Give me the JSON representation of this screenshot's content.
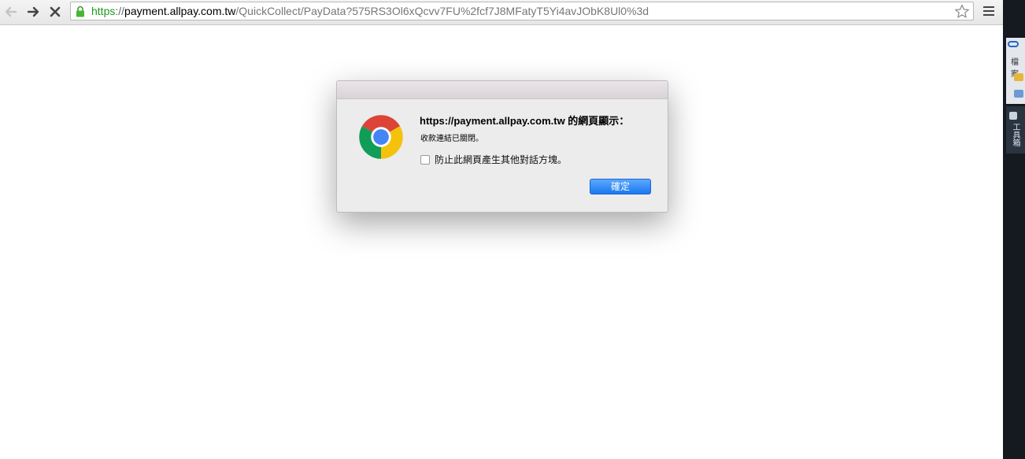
{
  "browser": {
    "url": {
      "scheme": "https",
      "separator": "://",
      "host": "payment.allpay.com.tw",
      "path": "/QuickCollect/PayData?575RS3Ol6xQcvv7FU%2fcf7J8MFatyT5Yi4avJObK8Ul0%3d"
    },
    "icons": {
      "back": "back-arrow-icon",
      "forward": "forward-arrow-icon",
      "stop": "stop-icon",
      "lock": "lock-icon",
      "star": "bookmark-star-icon",
      "menu": "hamburger-menu-icon"
    },
    "colors": {
      "secure_scheme": "#1a9b1a",
      "primary_button": "#1a78f0"
    }
  },
  "side_app": {
    "label_top": "檔案",
    "label_vertical": "工具箱"
  },
  "dialog": {
    "title": "https://payment.allpay.com.tw 的網頁顯示：",
    "message": "收款連結已關閉。",
    "checkbox_label": "防止此網頁產生其他對話方塊。",
    "checkbox_checked": false,
    "ok_label": "確定",
    "icon": "chrome-logo-icon"
  }
}
